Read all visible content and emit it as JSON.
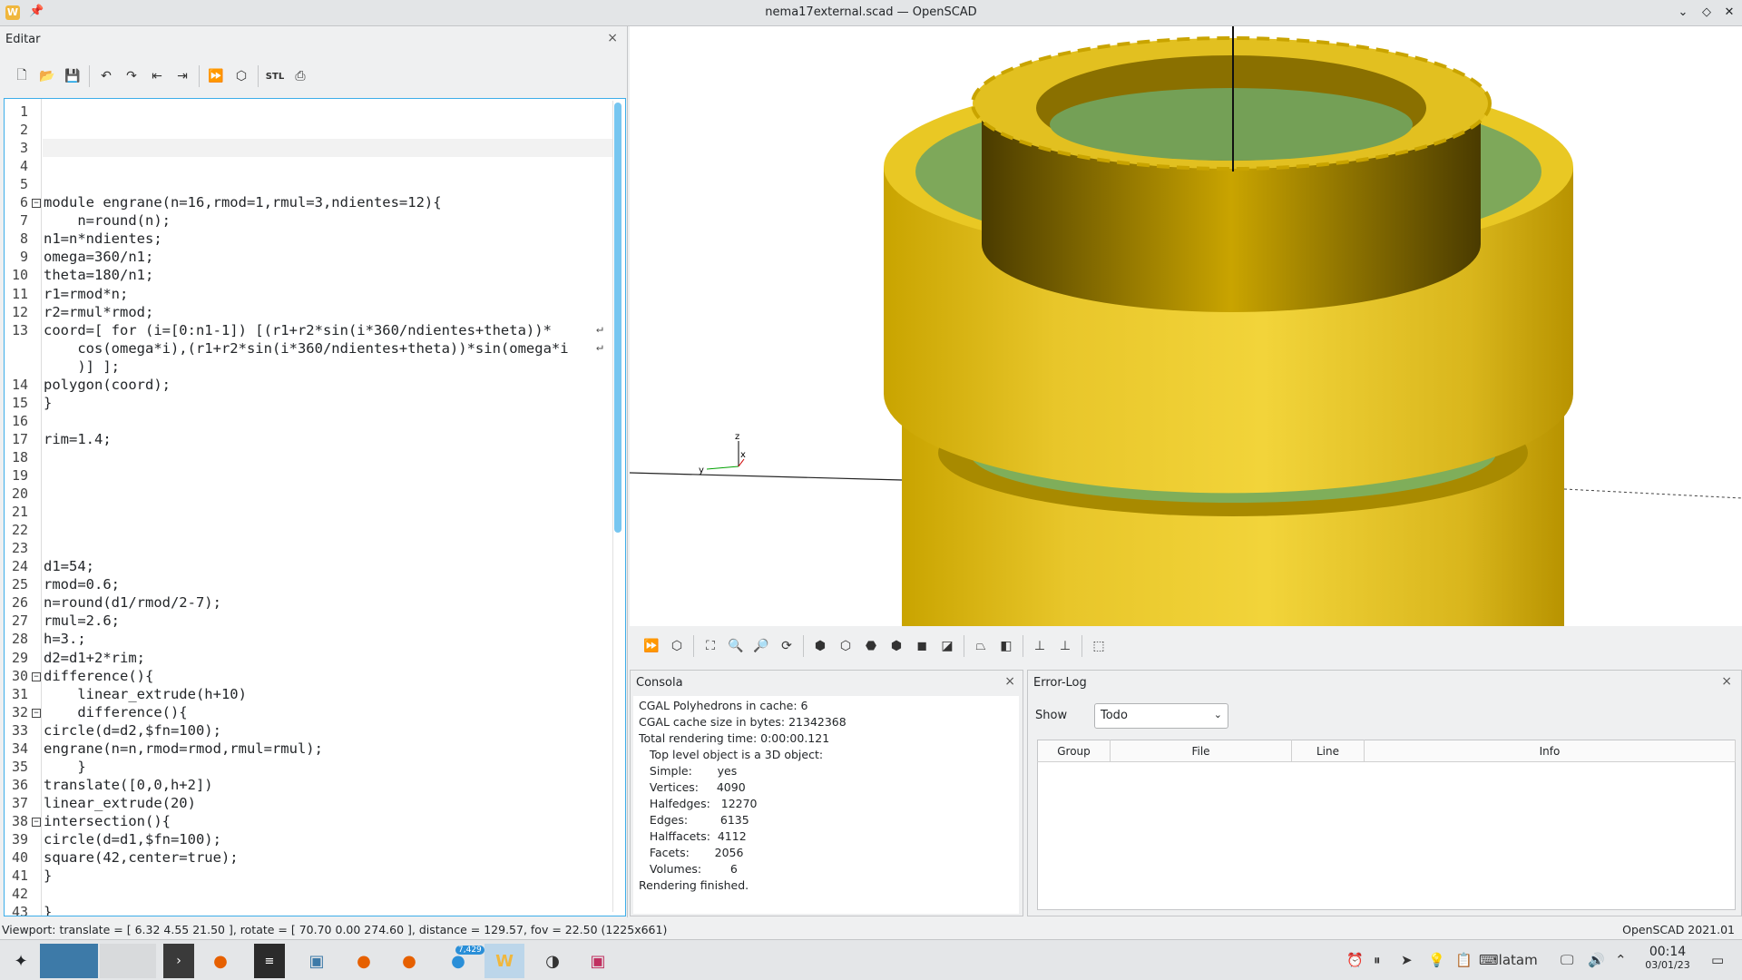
{
  "window": {
    "title": "nema17external.scad — OpenSCAD",
    "minimize": "⌄",
    "restore": "◇",
    "close": "✕",
    "app_icon": "W",
    "pin": "📌"
  },
  "editor": {
    "title": "Editar",
    "close": "×",
    "toolbar": [
      {
        "name": "new-file-icon",
        "glyph": "🗋"
      },
      {
        "name": "open-file-icon",
        "glyph": "📂"
      },
      {
        "name": "save-file-icon",
        "glyph": "💾"
      },
      {
        "sep": true
      },
      {
        "name": "undo-icon",
        "glyph": "↶"
      },
      {
        "name": "redo-icon",
        "glyph": "↷"
      },
      {
        "name": "unindent-icon",
        "glyph": "⇤"
      },
      {
        "name": "indent-icon",
        "glyph": "⇥"
      },
      {
        "sep": true
      },
      {
        "name": "preview-icon",
        "glyph": "⏩"
      },
      {
        "name": "render-icon",
        "glyph": "⬡"
      },
      {
        "sep": true
      },
      {
        "name": "export-stl-icon",
        "glyph": "STL"
      },
      {
        "name": "send-to-print-icon",
        "glyph": "⎙"
      }
    ],
    "lines": [
      {
        "n": "1",
        "t": ""
      },
      {
        "n": "2",
        "t": ""
      },
      {
        "n": "3",
        "t": ""
      },
      {
        "n": "4",
        "t": ""
      },
      {
        "n": "5",
        "t": ""
      },
      {
        "n": "6",
        "t": "module engrane(n=16,rmod=1,rmul=3,ndientes=12){",
        "fold": "⊟"
      },
      {
        "n": "7",
        "t": "    n=round(n);"
      },
      {
        "n": "8",
        "t": "n1=n*ndientes;"
      },
      {
        "n": "9",
        "t": "omega=360/n1;"
      },
      {
        "n": "10",
        "t": "theta=180/n1;"
      },
      {
        "n": "11",
        "t": "r1=rmod*n;"
      },
      {
        "n": "12",
        "t": "r2=rmul*rmod;"
      },
      {
        "n": "13",
        "t": "coord=[ for (i=[0:n1-1]) [(r1+r2*sin(i*360/ndientes+theta))*"
      },
      {
        "n": "",
        "t": "    cos(omega*i),(r1+r2*sin(i*360/ndientes+theta))*sin(omega*i"
      },
      {
        "n": "",
        "t": "    )] ];"
      },
      {
        "n": "14",
        "t": "polygon(coord);"
      },
      {
        "n": "15",
        "t": "}"
      },
      {
        "n": "16",
        "t": ""
      },
      {
        "n": "17",
        "t": "rim=1.4;"
      },
      {
        "n": "18",
        "t": ""
      },
      {
        "n": "19",
        "t": ""
      },
      {
        "n": "20",
        "t": ""
      },
      {
        "n": "21",
        "t": ""
      },
      {
        "n": "22",
        "t": ""
      },
      {
        "n": "23",
        "t": ""
      },
      {
        "n": "24",
        "t": "d1=54;"
      },
      {
        "n": "25",
        "t": "rmod=0.6;"
      },
      {
        "n": "26",
        "t": "n=round(d1/rmod/2-7);"
      },
      {
        "n": "27",
        "t": "rmul=2.6;"
      },
      {
        "n": "28",
        "t": "h=3.;"
      },
      {
        "n": "29",
        "t": "d2=d1+2*rim;"
      },
      {
        "n": "30",
        "t": "difference(){",
        "fold": "⊟"
      },
      {
        "n": "31",
        "t": "    linear_extrude(h+10)"
      },
      {
        "n": "32",
        "t": "    difference(){",
        "fold": "⊟"
      },
      {
        "n": "33",
        "t": "circle(d=d2,$fn=100);"
      },
      {
        "n": "34",
        "t": "engrane(n=n,rmod=rmod,rmul=rmul);"
      },
      {
        "n": "35",
        "t": "    }"
      },
      {
        "n": "36",
        "t": "translate([0,0,h+2])"
      },
      {
        "n": "37",
        "t": "linear_extrude(20)"
      },
      {
        "n": "38",
        "t": "intersection(){",
        "fold": "⊟"
      },
      {
        "n": "39",
        "t": "circle(d=d1,$fn=100);"
      },
      {
        "n": "40",
        "t": "square(42,center=true);"
      },
      {
        "n": "41",
        "t": "}"
      },
      {
        "n": "42",
        "t": ""
      },
      {
        "n": "43",
        "t": "}"
      }
    ],
    "wrap_marker": "↵"
  },
  "viewport": {
    "axis_z": "z",
    "axis_y": "y",
    "axis_x": "x"
  },
  "view_toolbar": [
    {
      "name": "preview-icon",
      "glyph": "⏩"
    },
    {
      "name": "render-icon",
      "glyph": "⬡"
    },
    {
      "name": "view-all-icon",
      "glyph": "⛶"
    },
    {
      "name": "zoom-in-icon",
      "glyph": "🔍"
    },
    {
      "name": "zoom-out-icon",
      "glyph": "🔎"
    },
    {
      "name": "reset-view-icon",
      "glyph": "⟳"
    },
    {
      "name": "view-right-icon",
      "glyph": "⬢"
    },
    {
      "name": "view-top-icon",
      "glyph": "⬡"
    },
    {
      "name": "view-bottom-icon",
      "glyph": "⬣"
    },
    {
      "name": "view-left-icon",
      "glyph": "⬢"
    },
    {
      "name": "view-front-icon",
      "glyph": "◼"
    },
    {
      "name": "view-back-icon",
      "glyph": "◪"
    },
    {
      "name": "perspective-icon",
      "glyph": "⏢"
    },
    {
      "name": "orthogonal-icon",
      "glyph": "◧"
    },
    {
      "name": "show-axes-icon",
      "glyph": "⊥"
    },
    {
      "name": "show-scale-icon",
      "glyph": "⊥"
    },
    {
      "name": "show-edges-icon",
      "glyph": "⬚"
    }
  ],
  "console": {
    "title": "Consola",
    "close": "×",
    "lines": [
      "CGAL Polyhedrons in cache: 6",
      "CGAL cache size in bytes: 21342368",
      "Total rendering time: 0:00:00.121",
      "   Top level object is a 3D object:",
      "   Simple:       yes",
      "   Vertices:     4090",
      "   Halfedges:   12270",
      "   Edges:         6135",
      "   Halffacets:  4112",
      "   Facets:       2056",
      "   Volumes:        6",
      "Rendering finished."
    ]
  },
  "errorlog": {
    "title": "Error-Log",
    "close": "×",
    "show_label": "Show",
    "filter_value": "Todo",
    "columns": [
      "Group",
      "File",
      "Line",
      "Info"
    ]
  },
  "status": {
    "viewport": "Viewport: translate = [ 6.32 4.55 21.50 ], rotate = [ 70.70 0.00 274.60 ], distance = 129.57, fov = 22.50 (1225x661)",
    "version": "OpenSCAD 2021.01"
  },
  "taskbar": {
    "badge": "7,429",
    "keyboard": "latam",
    "time": "00:14",
    "date": "03/01/23"
  }
}
